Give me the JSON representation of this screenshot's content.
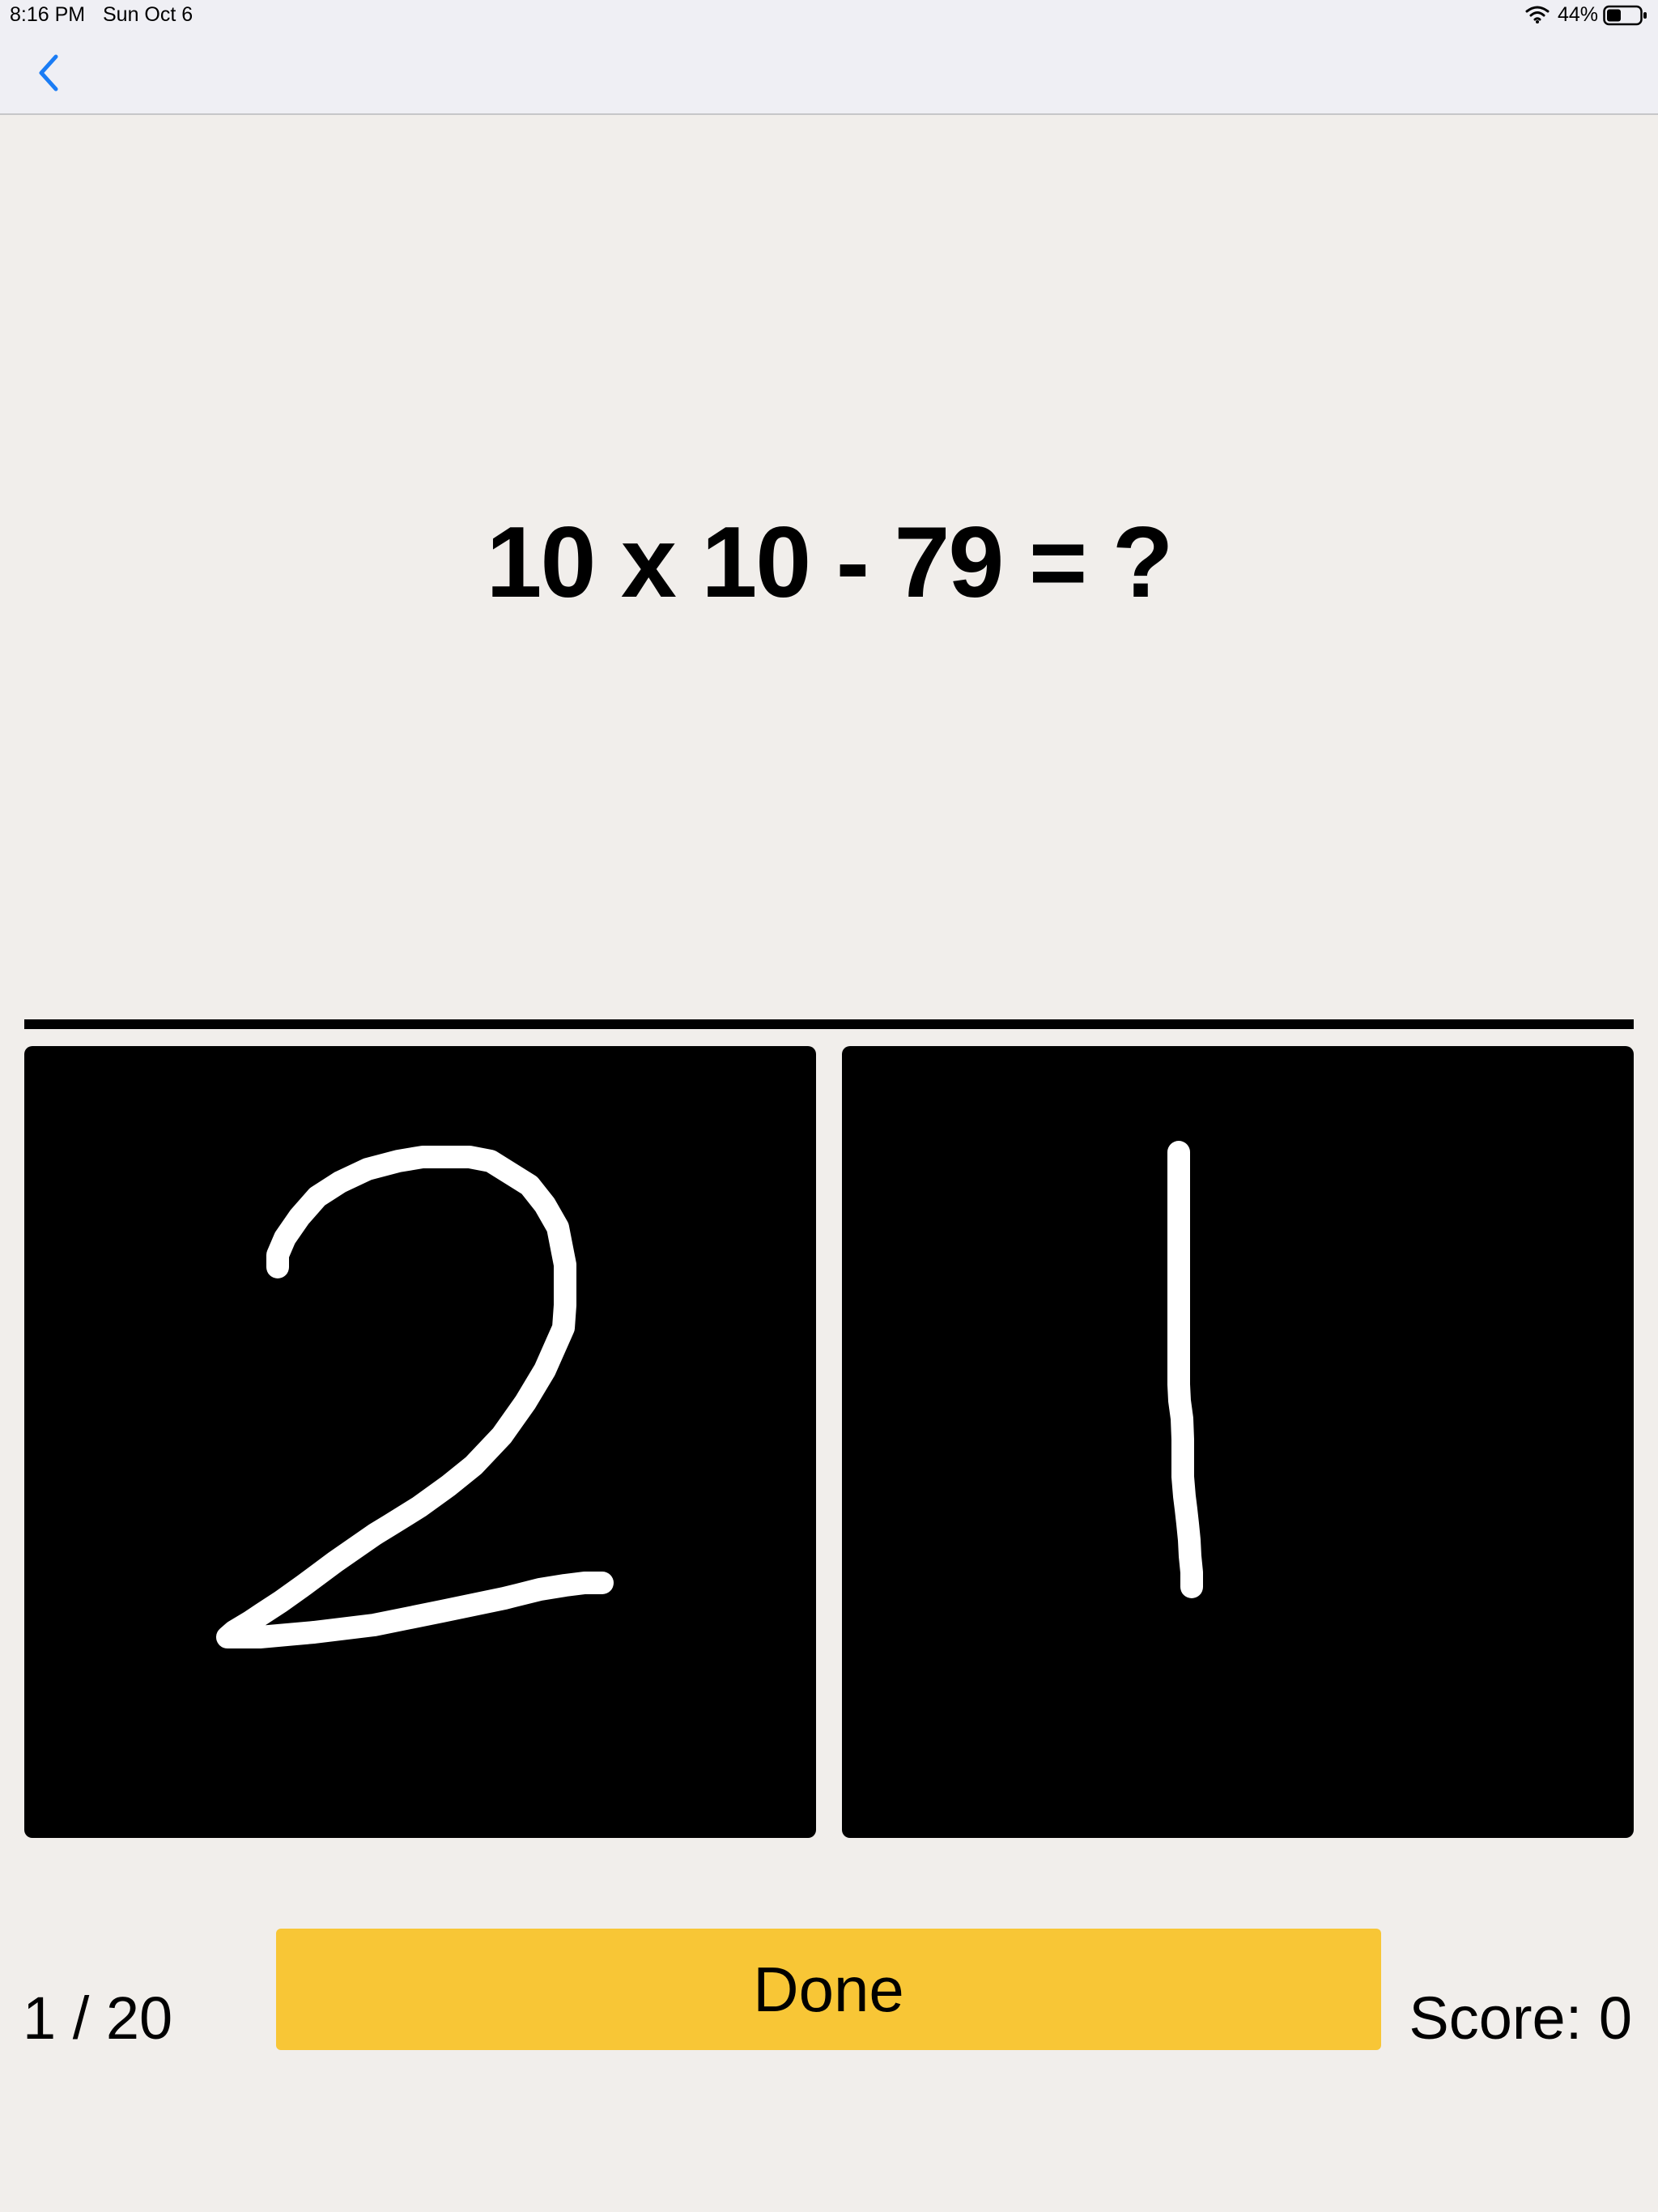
{
  "status_bar": {
    "time": "8:16 PM",
    "date": "Sun Oct 6",
    "battery_percent": "44%",
    "battery_level": 0.44,
    "wifi_icon": "wifi-icon",
    "battery_icon": "battery-icon"
  },
  "nav": {
    "back_icon": "chevron-left-icon",
    "accent_color": "#1a7cf5"
  },
  "question": {
    "text": "10 x 10 - 79 = ?"
  },
  "answer_pads": [
    {
      "digit": "2"
    },
    {
      "digit": "1"
    }
  ],
  "footer": {
    "progress": "1 / 20",
    "done_label": "Done",
    "score": "Score: 0"
  },
  "colors": {
    "background": "#f1eeeb",
    "pad": "#000000",
    "ink": "#ffffff",
    "done_button": "#f8c636"
  }
}
